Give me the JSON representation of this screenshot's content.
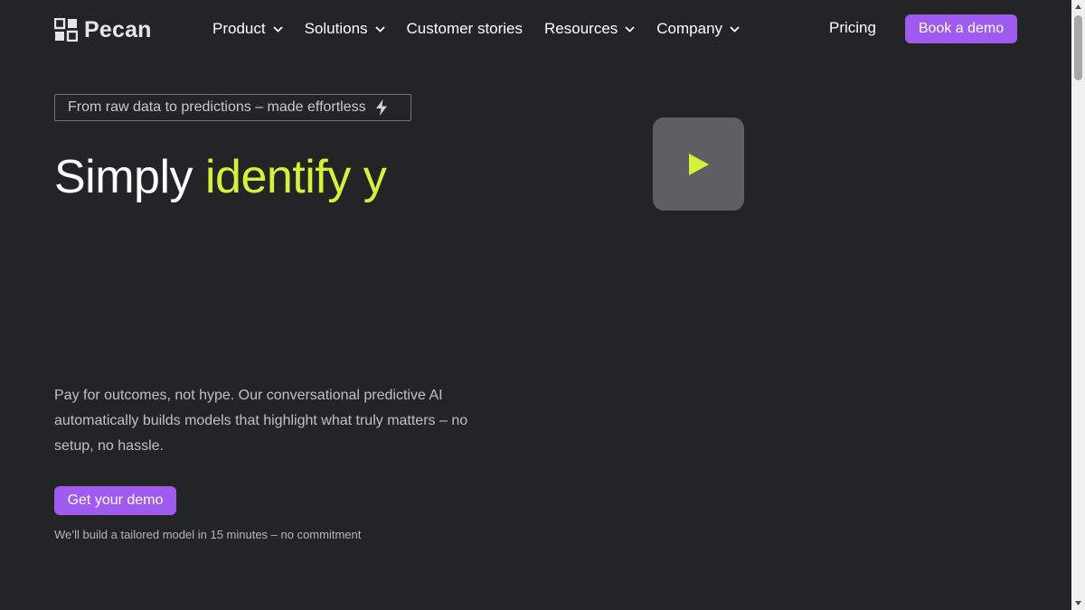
{
  "header": {
    "logo_text": "Pecan",
    "nav": [
      {
        "label": "Product",
        "has_dropdown": true
      },
      {
        "label": "Solutions",
        "has_dropdown": true
      },
      {
        "label": "Customer stories",
        "has_dropdown": false
      },
      {
        "label": "Resources",
        "has_dropdown": true
      },
      {
        "label": "Company",
        "has_dropdown": true
      }
    ],
    "pricing_label": "Pricing",
    "book_demo_label": "Book a demo"
  },
  "hero": {
    "tagline": "From raw data to predictions – made effortless",
    "headline_white": "Simply ",
    "headline_green": "identify y",
    "description": "Pay for outcomes, not hype. Our conversational predictive AI automatically builds models that highlight what truly matters – no setup, no hassle.",
    "cta_label": "Get your demo",
    "note": "We’ll build a tailored model in 15 minutes – no commitment"
  },
  "icons": {
    "logo": "pecan-logo-icon",
    "chevron": "chevron-down-icon",
    "bolt": "lightning-bolt-icon",
    "play": "play-icon"
  },
  "colors": {
    "background": "#222425",
    "accent_purple": "#9f5af0",
    "accent_green": "#d4f23c"
  }
}
